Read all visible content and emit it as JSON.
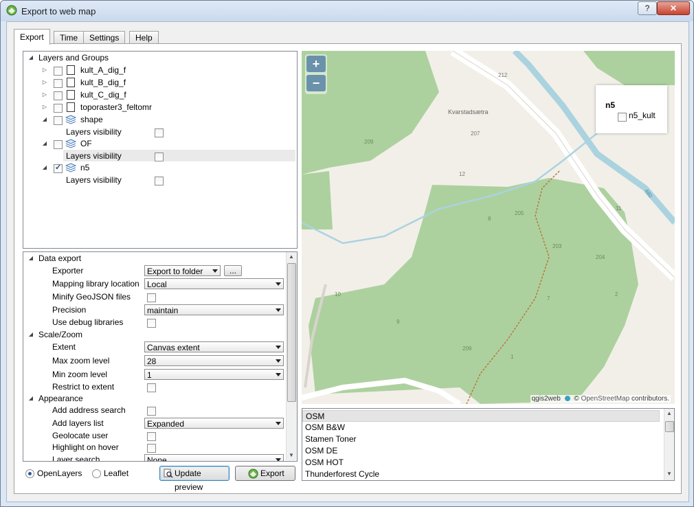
{
  "window": {
    "title": "Export to web map",
    "help_button": "?",
    "close_button": "✕"
  },
  "tabs": [
    {
      "label": "Export",
      "active": true
    },
    {
      "label": "Time"
    },
    {
      "label": "Settings"
    },
    {
      "label": "Help"
    }
  ],
  "layers_tree": {
    "root_label": "Layers and Groups",
    "items": [
      {
        "label": "kult_A_dig_f",
        "checked": false
      },
      {
        "label": "kult_B_dig_f",
        "checked": false
      },
      {
        "label": "kult_C_dig_f",
        "checked": false
      },
      {
        "label": "toporaster3_feltomr",
        "checked": false
      },
      {
        "label": "shape",
        "checked": false,
        "sub_label": "Layers visibility"
      },
      {
        "label": "OF",
        "checked": false,
        "sub_label": "Layers visibility"
      },
      {
        "label": "n5",
        "checked": true,
        "sub_label": "Layers visibility"
      }
    ]
  },
  "properties": {
    "data_export": {
      "header": "Data export",
      "exporter_label": "Exporter",
      "exporter_value": "Export to folder",
      "exporter_more": "...",
      "mapping_lib_label": "Mapping library location",
      "mapping_lib_value": "Local",
      "minify_label": "Minify GeoJSON files",
      "precision_label": "Precision",
      "precision_value": "maintain",
      "debug_label": "Use debug libraries"
    },
    "scale_zoom": {
      "header": "Scale/Zoom",
      "extent_label": "Extent",
      "extent_value": "Canvas extent",
      "max_zoom_label": "Max zoom level",
      "max_zoom_value": "28",
      "min_zoom_label": "Min zoom level",
      "min_zoom_value": "1",
      "restrict_label": "Restrict to extent"
    },
    "appearance": {
      "header": "Appearance",
      "address_search_label": "Add address search",
      "layers_list_label": "Add layers list",
      "layers_list_value": "Expanded",
      "geolocate_label": "Geolocate user",
      "highlight_label": "Highlight on hover",
      "layer_search_label": "Layer search",
      "layer_search_value": "None"
    }
  },
  "bottom": {
    "openlayers_label": "OpenLayers",
    "leaflet_label": "Leaflet",
    "selected_library": "OpenLayers",
    "update_preview_label": "Update preview",
    "export_label": "Export"
  },
  "map": {
    "zoom_in": "+",
    "zoom_out": "−",
    "legend_title": "n5",
    "legend_item": "n5_kult",
    "attribution_qgis": "qgis2web",
    "attribution_osm_symbol": "©",
    "attribution_osm": "OpenStreetMap",
    "attribution_tail": " contributors.",
    "labels": [
      "212",
      "Kvarstadsætra",
      "207",
      "209",
      "12",
      "205",
      "8",
      "203",
      "204",
      "7",
      "2",
      "10",
      "9",
      "209",
      "1",
      "11",
      "480"
    ]
  },
  "basemaps": {
    "items": [
      "OSM",
      "OSM B&W",
      "Stamen Toner",
      "OSM DE",
      "OSM HOT",
      "Thunderforest Cycle"
    ],
    "selected": "OSM"
  },
  "colors": {
    "forest": "#add19e",
    "land": "#f2efe9",
    "water": "#aad3df",
    "road": "#ffffff",
    "path": "#b3793d"
  }
}
